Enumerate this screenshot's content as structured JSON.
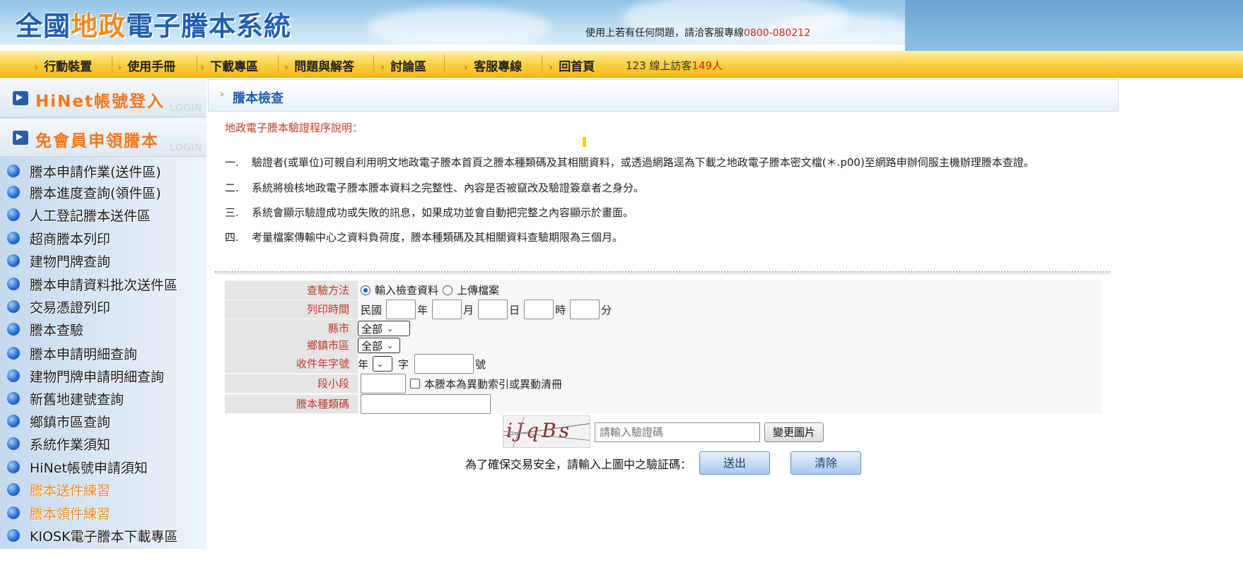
{
  "header": {
    "logo_part1": "全國",
    "logo_part2": "地政",
    "logo_part3": "電子謄本系統",
    "hotline_text": "使用上若有任何問題，請洽客服專線",
    "hotline_number": "0800-080212"
  },
  "nav": {
    "items": [
      "行動裝置",
      "使用手冊",
      "下載專區",
      "問題與解答",
      "討論區",
      "客服專線",
      "回首頁"
    ],
    "visitor_prefix": "123  線上訪客",
    "visitor_count": "149",
    "visitor_suffix": "人"
  },
  "sidebar": {
    "login_boxes": [
      {
        "label": "HiNet帳號登入",
        "watermark": "LOGIN"
      },
      {
        "label": "免會員申領謄本",
        "watermark": "LOGIN"
      }
    ],
    "items": [
      {
        "label": "謄本申請作業(送件區)"
      },
      {
        "label": "謄本進度查詢(領件區)"
      },
      {
        "label": "人工登記謄本送件區"
      },
      {
        "label": "超商謄本列印"
      },
      {
        "label": "建物門牌查詢"
      },
      {
        "label": "謄本申請資料批次送件區"
      },
      {
        "label": "交易憑證列印"
      },
      {
        "label": "謄本查驗"
      },
      {
        "label": "謄本申請明細查詢"
      },
      {
        "label": "建物門牌申請明細查詢"
      },
      {
        "label": "新舊地建號查詢"
      },
      {
        "label": "鄉鎮市區查詢"
      },
      {
        "label": "系統作業須知"
      },
      {
        "label": "HiNet帳號申請須知"
      },
      {
        "label": "謄本送件練習"
      },
      {
        "label": "謄本領件練習"
      },
      {
        "label": "KIOSK電子謄本下載專區"
      }
    ]
  },
  "main": {
    "title": "謄本檢查",
    "intro": "地政電子謄本驗證程序說明：",
    "steps": [
      {
        "no": "一.",
        "text": "驗證者(或單位)可親自利用明文地政電子謄本首頁之謄本種類碼及其相關資料，或透過網路逕為下載之地政電子謄本密文檔(＊.p00)至網路申辦伺服主機辦理謄本查證。"
      },
      {
        "no": "二.",
        "text": "系統將檢核地政電子謄本謄本資料之完整性、內容是否被竄改及驗證簽章者之身分。"
      },
      {
        "no": "三.",
        "text": "系統會顯示驗證成功或失敗的訊息，如果成功並會自動把完整之內容顯示於畫面。"
      },
      {
        "no": "四.",
        "text": "考量檔案傳輸中心之資料負荷度，謄本種類碼及其相關資料查驗期限為三個月。"
      }
    ]
  },
  "form": {
    "method_label": "查驗方法",
    "method_option1": "輸入檢查資料",
    "method_option2": "上傳檔案",
    "print_time_label": "列印時間",
    "era": "民國",
    "unit_year": "年",
    "unit_month": "月",
    "unit_day": "日",
    "unit_hour": "時",
    "unit_minute": "分",
    "city_label": "縣市",
    "city_value": "全部",
    "district_label": "鄉鎮市區",
    "district_value": "全部",
    "receipt_label": "收件年字號",
    "receipt_year": "年",
    "receipt_char": "字",
    "receipt_no": "號",
    "section_label": "段小段",
    "section_checkbox": "本謄本為異動索引或異動清冊",
    "type_code_label": "謄本種類碼"
  },
  "captcha": {
    "image_text": "iJqBs",
    "input_placeholder": "請輸入驗證碼",
    "refresh_button": "變更圖片",
    "confirm_text": "為了確保交易安全，請輸入上圖中之驗証碼：",
    "submit_button": "送出",
    "clear_button": "清除"
  },
  "colors": {
    "accent_orange": "#f08a1c",
    "link_blue": "#1f5fb0",
    "label_red": "#c0392b",
    "nav_yellow": "#fcd34a"
  }
}
